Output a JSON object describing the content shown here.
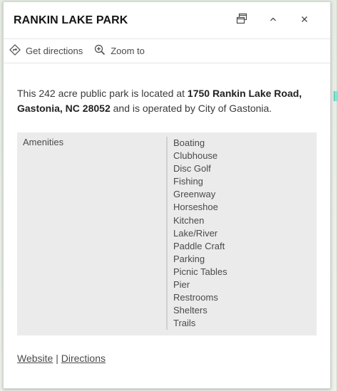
{
  "popup": {
    "title": "RANKIN LAKE PARK",
    "actions": {
      "get_directions": "Get directions",
      "zoom_to": "Zoom to"
    },
    "description": {
      "prefix": "This 242 acre public park is located at ",
      "address": "1750 Rankin Lake Road, Gastonia, NC 28052",
      "suffix": " and is operated by City of Gastonia."
    },
    "attributes": {
      "key": "Amenities",
      "values": [
        "Boating",
        "Clubhouse",
        "Disc Golf",
        "Fishing",
        "Greenway",
        "Horseshoe",
        "Kitchen",
        "Lake/River",
        "Paddle Craft",
        "Parking",
        "Picnic Tables",
        "Pier",
        "Restrooms",
        "Shelters",
        "Trails"
      ]
    },
    "links": {
      "website": "Website",
      "separator": " | ",
      "directions": "Directions"
    }
  },
  "icons": {
    "dock": "dock-icon",
    "collapse": "chevron-up-icon",
    "close": "close-icon",
    "directions": "directions-icon",
    "zoom": "zoom-in-icon"
  }
}
